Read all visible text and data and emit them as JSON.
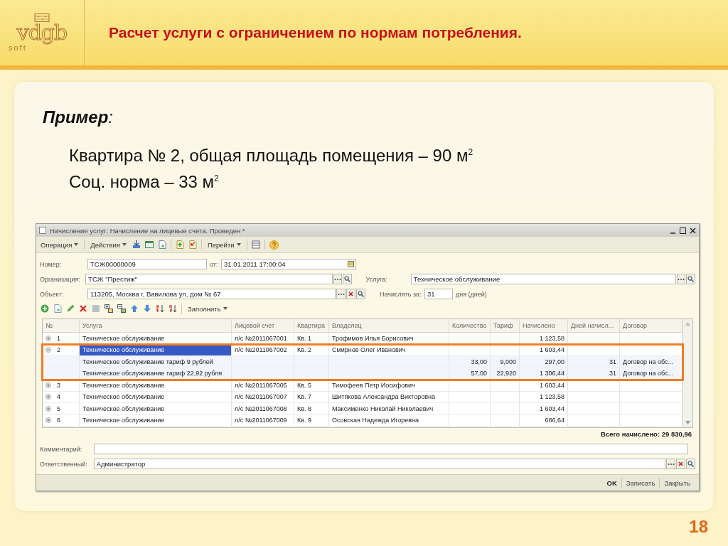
{
  "slide": {
    "logo": {
      "mark": "vdgb",
      "sub": "soft"
    },
    "title": "Расчет услуги с ограничением по нормам потребления.",
    "example_label": "**Пример**:",
    "lines": [
      "Квартира № 2, общая площадь помещения – 90 м$^{2}$",
      "Соц. норма – 33 м$^{2}$"
    ],
    "page_number": "18"
  },
  "window": {
    "title": "Начисление услуг: Начисление на лицевые счета. Проведен *",
    "menus": [
      "Операция",
      "Действия",
      "Перейти"
    ],
    "fields": {
      "number": {
        "label": "Номер:",
        "value": "ТСЖ00000009"
      },
      "date": {
        "label": "от:",
        "value": "31.01.2011 17:00:04"
      },
      "organization": {
        "label": "Организация:",
        "value": "ТСЖ \"Престиж\""
      },
      "object": {
        "label": "Объект:",
        "value": "113205, Москва г, Вавилова ул, дом № 67"
      },
      "service": {
        "label": "Услуга:",
        "value": "Техническое обслуживание"
      },
      "charge_for": {
        "label": "Начислять за:",
        "value": "31",
        "unit": "дня (дней)"
      }
    },
    "table_menu": "Заполнить",
    "table": {
      "columns": [
        "№",
        "Услуга",
        "Лицевой счет",
        "Квартира",
        "Владелец",
        "Количество",
        "Тариф",
        "Начислено",
        "Дней начисл...",
        "Договор"
      ],
      "rows": [
        {
          "number": "1",
          "service": "Техническое обслуживание",
          "account": "л/с №2011067001",
          "apartment": "Кв. 1",
          "owner": "Трофимов Илья Борисович",
          "charged": "1 123,58",
          "expanded": false,
          "selected": false,
          "highlighted": false
        },
        {
          "number": "2",
          "service": "Техническое обслуживание",
          "account": "л/с №2011067002",
          "apartment": "Кв. 2",
          "owner": "Смирнов Олег Иванович",
          "charged": "1 603,44",
          "expanded": true,
          "selected": true,
          "highlighted": true,
          "children": [
            {
              "service": "Техническое обслуживание тариф 9 рублей",
              "quantity": "33,00",
              "tariff": "9,000",
              "charged": "297,00",
              "days": "31",
              "contract": "Договор на обс..."
            },
            {
              "service": "Техническое обслуживание тариф 22,92 рубля",
              "quantity": "57,00",
              "tariff": "22,920",
              "charged": "1 306,44",
              "days": "31",
              "contract": "Договор на обс..."
            }
          ]
        },
        {
          "number": "3",
          "service": "Техническое обслуживание",
          "account": "л/с №2011067005",
          "apartment": "Кв. 5",
          "owner": "Тимофеев Петр Иосифович",
          "charged": "1 603,44",
          "expanded": false,
          "selected": false,
          "highlighted": false
        },
        {
          "number": "4",
          "service": "Техническое обслуживание",
          "account": "л/с №2011067007",
          "apartment": "Кв. 7",
          "owner": "Шитякова Александра Викторовна",
          "charged": "1 123,58",
          "expanded": false,
          "selected": false,
          "highlighted": false
        },
        {
          "number": "5",
          "service": "Техническое обслуживание",
          "account": "л/с №2011067008",
          "apartment": "Кв. 8",
          "owner": "Максименко Николай Николаевич",
          "charged": "1 603,44",
          "expanded": false,
          "selected": false,
          "highlighted": false
        },
        {
          "number": "6",
          "service": "Техническое обслуживание",
          "account": "л/с №2011067009",
          "apartment": "Кв. 9",
          "owner": "Осовская Надежда Игоревна",
          "charged": "686,64",
          "expanded": false,
          "selected": false,
          "highlighted": false
        }
      ]
    },
    "total": "Всего начислено: 29 830,96",
    "comment": {
      "label": "Комментарий:"
    },
    "responsible": {
      "label": "Ответственный:",
      "value": "Администратор"
    },
    "buttons": [
      {
        "label": "OK",
        "default": true
      },
      {
        "label": "Записать",
        "default": false
      },
      {
        "label": "Закрыть",
        "default": false
      }
    ]
  }
}
